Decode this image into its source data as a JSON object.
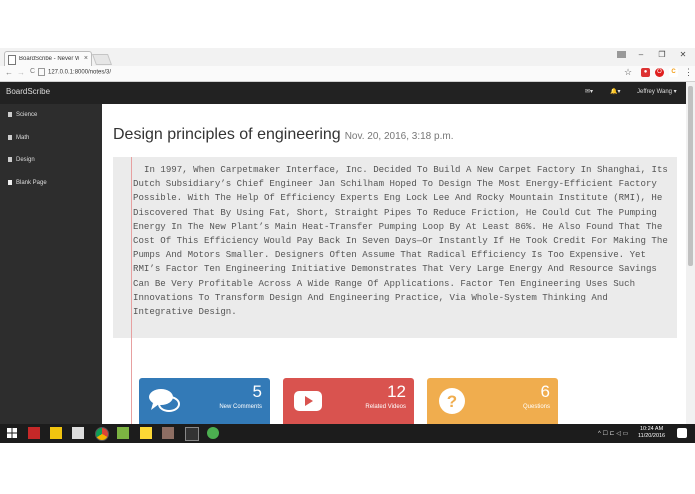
{
  "browser": {
    "tab_title": "BoardScribe - Never Wri",
    "tab_close": "×",
    "url": "127.0.0.1:8000/notes/3/",
    "back": "←",
    "forward": "→",
    "reload": "C",
    "minimize": "–",
    "restore": "❐",
    "close": "✕",
    "star": "☆",
    "menu": "⋮"
  },
  "navbar": {
    "brand": "BoardScribe",
    "mail_icon": "✉▾",
    "bell_icon": "🔔▾",
    "user": "Jeffrey Wang ▾"
  },
  "sidebar": {
    "items": [
      {
        "label": "Science",
        "icon": "book-icon"
      },
      {
        "label": "Math",
        "icon": "book-icon"
      },
      {
        "label": "Design",
        "icon": "book-icon"
      },
      {
        "label": "Blank Page",
        "icon": "file-icon"
      }
    ]
  },
  "note": {
    "title": "Design principles of engineering",
    "date": "Nov. 20, 2016, 3:18 p.m.",
    "body": "In 1997, When Carpetmaker Interface, Inc. Decided To Build A New Carpet Factory In Shanghai, Its Dutch Subsidiary’s Chief Engineer Jan Schilham Hoped To Design The Most Energy-Efficient Factory Possible. With The Help Of Efficiency Experts Eng Lock Lee And Rocky Mountain Institute (RMI), He Discovered That By Using Fat, Short, Straight Pipes To Reduce Friction, He Could Cut The Pumping Energy In The New Plant’s Main Heat-Transfer Pumping Loop By At Least 86%. He Also Found That The Cost Of This Efficiency Would Pay Back In Seven Days—Or Instantly If He Took Credit For Making The Pumps And Motors Smaller. Designers Often Assume That Radical Efficiency Is Too Expensive. Yet RMI’s Factor Ten Engineering Initiative Demonstrates That Very Large Energy And Resource Savings Can Be Very Profitable Across A Wide Range Of Applications. Factor Ten Engineering Uses Such Innovations To Transform Design And Engineering Practice, Via Whole-System Thinking And Integrative Design."
  },
  "cards": [
    {
      "count": "5",
      "label": "New Comments",
      "color": "#337ab7",
      "icon": "comments-icon"
    },
    {
      "count": "12",
      "label": "Related Videos",
      "color": "#d9534f",
      "icon": "youtube-play-icon"
    },
    {
      "count": "6",
      "label": "Questions",
      "color": "#f0ad4e",
      "icon": "question-icon"
    }
  ],
  "taskbar": {
    "time": "10:24 AM",
    "date": "11/20/2016",
    "tray": "^ ☐ ⊏ ◁ ▭"
  }
}
